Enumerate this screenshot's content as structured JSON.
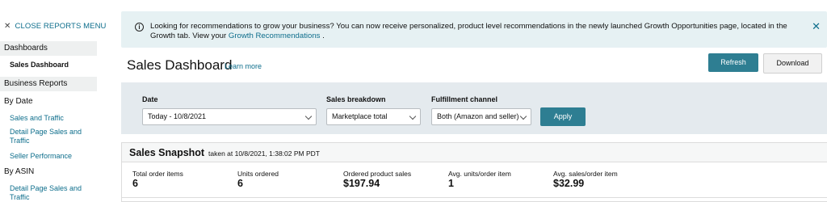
{
  "sidebar": {
    "close_label": "CLOSE REPORTS MENU",
    "sections": [
      {
        "label": "Dashboards"
      },
      {
        "label": "Business Reports"
      }
    ],
    "active_item": "Sales Dashboard",
    "by_date_label": "By Date",
    "by_date_links": [
      "Sales and Traffic",
      "Detail Page Sales and Traffic",
      "Seller Performance"
    ],
    "by_asin_label": "By ASIN",
    "by_asin_links": [
      "Detail Page Sales and Traffic"
    ]
  },
  "banner": {
    "message": "Looking for recommendations to grow your business? You can now receive personalized, product level recommendations in the newly launched Growth Opportunities page, located in the Growth tab. View your",
    "link_text": "Growth Recommendations",
    "suffix": "."
  },
  "header": {
    "title": "Sales Dashboard",
    "learn_more": "Learn more",
    "refresh_label": "Refresh",
    "download_label": "Download"
  },
  "filters": {
    "date_label": "Date",
    "date_value": "Today - 10/8/2021",
    "breakdown_label": "Sales breakdown",
    "breakdown_value": "Marketplace total",
    "fulfillment_label": "Fulfillment channel",
    "fulfillment_value": "Both (Amazon and seller)",
    "apply_label": "Apply"
  },
  "snapshot": {
    "title": "Sales Snapshot",
    "taken_at": "taken at 10/8/2021, 1:38:02 PM PDT",
    "metrics": [
      {
        "label": "Total order items",
        "value": "6"
      },
      {
        "label": "Units ordered",
        "value": "6"
      },
      {
        "label": "Ordered product sales",
        "value": "$197.94"
      },
      {
        "label": "Avg. units/order item",
        "value": "1"
      },
      {
        "label": "Avg. sales/order item",
        "value": "$32.99"
      }
    ]
  },
  "colors": {
    "accent": "#2e7e92",
    "link": "#0e6e8c",
    "banner_bg": "#e6f1f3",
    "filter_bg": "#e4eaee"
  }
}
